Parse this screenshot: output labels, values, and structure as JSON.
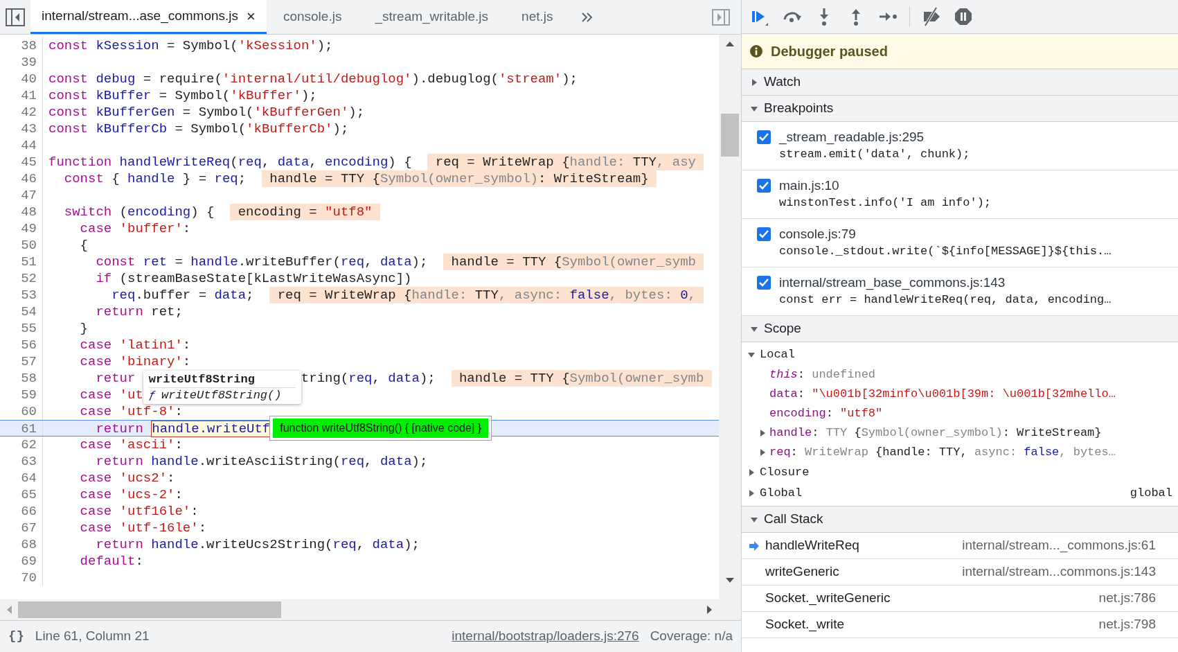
{
  "tabs": [
    {
      "label": "internal/stream...ase_commons.js",
      "selected": true,
      "close": "×"
    },
    {
      "label": "console.js",
      "selected": false
    },
    {
      "label": "_stream_writable.js",
      "selected": false
    },
    {
      "label": "net.js",
      "selected": false
    }
  ],
  "code": {
    "lines": [
      {
        "number": "38",
        "current": false,
        "tokens": [
          {
            "kind": "keyword",
            "text": "const"
          },
          {
            "kind": "variable",
            "text": " kSession"
          },
          {
            "kind": "plain",
            "text": " = Symbol("
          },
          {
            "kind": "string",
            "text": "'kSession'"
          },
          {
            "kind": "plain",
            "text": ");"
          }
        ]
      },
      {
        "number": "39",
        "current": false
      },
      {
        "number": "40",
        "current": false,
        "tokens": [
          {
            "kind": "keyword",
            "text": "const"
          },
          {
            "kind": "variable",
            "text": " debug"
          },
          {
            "kind": "plain",
            "text": " = require("
          },
          {
            "kind": "string",
            "text": "'internal/util/debuglog'"
          },
          {
            "kind": "plain",
            "text": ").debuglog("
          },
          {
            "kind": "string",
            "text": "'stream'"
          },
          {
            "kind": "plain",
            "text": ");"
          }
        ]
      },
      {
        "number": "41",
        "current": false,
        "tokens": [
          {
            "kind": "keyword",
            "text": "const"
          },
          {
            "kind": "variable",
            "text": " kBuffer"
          },
          {
            "kind": "plain",
            "text": " = Symbol("
          },
          {
            "kind": "string",
            "text": "'kBuffer'"
          },
          {
            "kind": "plain",
            "text": ");"
          }
        ]
      },
      {
        "number": "42",
        "current": false,
        "tokens": [
          {
            "kind": "keyword",
            "text": "const"
          },
          {
            "kind": "variable",
            "text": " kBufferGen"
          },
          {
            "kind": "plain",
            "text": " = Symbol("
          },
          {
            "kind": "string",
            "text": "'kBufferGen'"
          },
          {
            "kind": "plain",
            "text": ");"
          }
        ]
      },
      {
        "number": "43",
        "current": false,
        "tokens": [
          {
            "kind": "keyword",
            "text": "const"
          },
          {
            "kind": "variable",
            "text": " kBufferCb"
          },
          {
            "kind": "plain",
            "text": " = Symbol("
          },
          {
            "kind": "string",
            "text": "'kBufferCb'"
          },
          {
            "kind": "plain",
            "text": ");"
          }
        ]
      },
      {
        "number": "44",
        "current": false
      },
      {
        "number": "45",
        "current": false,
        "tokens": [
          {
            "kind": "keyword",
            "text": "function"
          },
          {
            "kind": "variable",
            "text": " handleWriteReq"
          },
          {
            "kind": "plain",
            "text": "("
          },
          {
            "kind": "variable",
            "text": "req"
          },
          {
            "kind": "plain",
            "text": ", "
          },
          {
            "kind": "variable",
            "text": "data"
          },
          {
            "kind": "plain",
            "text": ", "
          },
          {
            "kind": "variable",
            "text": "encoding"
          },
          {
            "kind": "plain",
            "text": ") {"
          }
        ],
        "inline_value": [
          {
            "kind": "plain",
            "text": "req = WriteWrap {"
          },
          {
            "kind": "dim",
            "text": "handle: "
          },
          {
            "kind": "plain",
            "text": "TTY"
          },
          {
            "kind": "dim",
            "text": ", asy"
          }
        ]
      },
      {
        "number": "46",
        "current": false,
        "tokens": [
          {
            "kind": "keyword",
            "text": "  const"
          },
          {
            "kind": "plain",
            "text": " { "
          },
          {
            "kind": "variable",
            "text": "handle"
          },
          {
            "kind": "plain",
            "text": " } = "
          },
          {
            "kind": "variable",
            "text": "req"
          },
          {
            "kind": "plain",
            "text": ";"
          }
        ],
        "inline_value": [
          {
            "kind": "plain",
            "text": "handle = TTY {"
          },
          {
            "kind": "dim",
            "text": "Symbol(owner_symbol)"
          },
          {
            "kind": "plain",
            "text": ": WriteStream}"
          }
        ]
      },
      {
        "number": "47",
        "current": false
      },
      {
        "number": "48",
        "current": false,
        "tokens": [
          {
            "kind": "keyword",
            "text": "  switch"
          },
          {
            "kind": "plain",
            "text": " ("
          },
          {
            "kind": "variable",
            "text": "encoding"
          },
          {
            "kind": "plain",
            "text": ") {"
          }
        ],
        "inline_value": [
          {
            "kind": "plain",
            "text": "encoding = "
          },
          {
            "kind": "string",
            "text": "\"utf8\""
          }
        ]
      },
      {
        "number": "49",
        "current": false,
        "tokens": [
          {
            "kind": "keyword",
            "text": "    case"
          },
          {
            "kind": "string",
            "text": " 'buffer'"
          },
          {
            "kind": "plain",
            "text": ":"
          }
        ]
      },
      {
        "number": "50",
        "current": false,
        "tokens": [
          {
            "kind": "plain",
            "text": "    {"
          }
        ]
      },
      {
        "number": "51",
        "current": false,
        "tokens": [
          {
            "kind": "keyword",
            "text": "      const"
          },
          {
            "kind": "variable",
            "text": " ret"
          },
          {
            "kind": "plain",
            "text": " = "
          },
          {
            "kind": "variable",
            "text": "handle"
          },
          {
            "kind": "plain",
            "text": ".writeBuffer("
          },
          {
            "kind": "variable",
            "text": "req"
          },
          {
            "kind": "plain",
            "text": ", "
          },
          {
            "kind": "variable",
            "text": "data"
          },
          {
            "kind": "plain",
            "text": ");"
          }
        ],
        "inline_value": [
          {
            "kind": "plain",
            "text": "handle = TTY {"
          },
          {
            "kind": "dim",
            "text": "Symbol(owner_symb"
          }
        ]
      },
      {
        "number": "52",
        "current": false,
        "tokens": [
          {
            "kind": "keyword",
            "text": "      if"
          },
          {
            "kind": "plain",
            "text": " (streamBaseState[kLastWriteWasAsync])"
          }
        ]
      },
      {
        "number": "53",
        "current": false,
        "tokens": [
          {
            "kind": "variable",
            "text": "        req"
          },
          {
            "kind": "plain",
            "text": ".buffer = "
          },
          {
            "kind": "variable",
            "text": "data"
          },
          {
            "kind": "plain",
            "text": ";"
          }
        ],
        "inline_value": [
          {
            "kind": "plain",
            "text": "req = WriteWrap {"
          },
          {
            "kind": "dim",
            "text": "handle: "
          },
          {
            "kind": "plain",
            "text": "TTY"
          },
          {
            "kind": "dim",
            "text": ", async: "
          },
          {
            "kind": "literal",
            "text": "false"
          },
          {
            "kind": "dim",
            "text": ", bytes: "
          },
          {
            "kind": "literal",
            "text": "0"
          },
          {
            "kind": "dim",
            "text": ","
          }
        ]
      },
      {
        "number": "54",
        "current": false,
        "tokens": [
          {
            "kind": "keyword",
            "text": "      return"
          },
          {
            "kind": "plain",
            "text": " ret;"
          }
        ]
      },
      {
        "number": "55",
        "current": false,
        "tokens": [
          {
            "kind": "plain",
            "text": "    }"
          }
        ]
      },
      {
        "number": "56",
        "current": false,
        "tokens": [
          {
            "kind": "keyword",
            "text": "    case"
          },
          {
            "kind": "string",
            "text": " 'latin1'"
          },
          {
            "kind": "plain",
            "text": ":"
          }
        ]
      },
      {
        "number": "57",
        "current": false,
        "tokens": [
          {
            "kind": "keyword",
            "text": "    case"
          },
          {
            "kind": "string",
            "text": " 'binary'"
          },
          {
            "kind": "plain",
            "text": ":"
          }
        ]
      },
      {
        "number": "58",
        "current": false,
        "tokens": [
          {
            "kind": "keyword",
            "text": "      retur"
          },
          {
            "kind": "gap"
          },
          {
            "kind": "plain",
            "text": "tring("
          },
          {
            "kind": "variable",
            "text": "req"
          },
          {
            "kind": "plain",
            "text": ", "
          },
          {
            "kind": "variable",
            "text": "data"
          },
          {
            "kind": "plain",
            "text": ");"
          }
        ],
        "inline_value": [
          {
            "kind": "plain",
            "text": "handle = TTY {"
          },
          {
            "kind": "dim",
            "text": "Symbol(owner_symb"
          }
        ]
      },
      {
        "number": "59",
        "current": false,
        "tokens": [
          {
            "kind": "keyword",
            "text": "    case"
          },
          {
            "kind": "string",
            "text": " 'ut"
          }
        ]
      },
      {
        "number": "60",
        "current": false,
        "tokens": [
          {
            "kind": "keyword",
            "text": "    case"
          },
          {
            "kind": "string",
            "text": " 'utf-8'"
          },
          {
            "kind": "plain",
            "text": ":"
          }
        ]
      },
      {
        "number": "61",
        "current": true,
        "tokens": [
          {
            "kind": "keyword",
            "text": "      return "
          },
          {
            "kind": "hovered",
            "text": "handle.writeUtf"
          }
        ]
      },
      {
        "number": "62",
        "current": false,
        "tokens": [
          {
            "kind": "keyword",
            "text": "    case"
          },
          {
            "kind": "string",
            "text": " 'ascii'"
          },
          {
            "kind": "plain",
            "text": ":"
          }
        ]
      },
      {
        "number": "63",
        "current": false,
        "tokens": [
          {
            "kind": "keyword",
            "text": "      return"
          },
          {
            "kind": "variable",
            "text": " handle"
          },
          {
            "kind": "plain",
            "text": ".writeAsciiString("
          },
          {
            "kind": "variable",
            "text": "req"
          },
          {
            "kind": "plain",
            "text": ", "
          },
          {
            "kind": "variable",
            "text": "data"
          },
          {
            "kind": "plain",
            "text": ");"
          }
        ]
      },
      {
        "number": "64",
        "current": false,
        "tokens": [
          {
            "kind": "keyword",
            "text": "    case"
          },
          {
            "kind": "string",
            "text": " 'ucs2'"
          },
          {
            "kind": "plain",
            "text": ":"
          }
        ]
      },
      {
        "number": "65",
        "current": false,
        "tokens": [
          {
            "kind": "keyword",
            "text": "    case"
          },
          {
            "kind": "string",
            "text": " 'ucs-2'"
          },
          {
            "kind": "plain",
            "text": ":"
          }
        ]
      },
      {
        "number": "66",
        "current": false,
        "tokens": [
          {
            "kind": "keyword",
            "text": "    case"
          },
          {
            "kind": "string",
            "text": " 'utf16le'"
          },
          {
            "kind": "plain",
            "text": ":"
          }
        ]
      },
      {
        "number": "67",
        "current": false,
        "tokens": [
          {
            "kind": "keyword",
            "text": "    case"
          },
          {
            "kind": "string",
            "text": " 'utf-16le'"
          },
          {
            "kind": "plain",
            "text": ":"
          }
        ]
      },
      {
        "number": "68",
        "current": false,
        "tokens": [
          {
            "kind": "keyword",
            "text": "      return"
          },
          {
            "kind": "variable",
            "text": " handle"
          },
          {
            "kind": "plain",
            "text": ".writeUcs2String("
          },
          {
            "kind": "variable",
            "text": "req"
          },
          {
            "kind": "plain",
            "text": ", "
          },
          {
            "kind": "variable",
            "text": "data"
          },
          {
            "kind": "plain",
            "text": ");"
          }
        ]
      },
      {
        "number": "69",
        "current": false,
        "tokens": [
          {
            "kind": "keyword",
            "text": "    default"
          },
          {
            "kind": "plain",
            "text": ":"
          }
        ]
      },
      {
        "number": "70",
        "current": false
      }
    ],
    "popover": {
      "title": "writeUtf8String",
      "glyph": "ƒ",
      "signature": "writeUtf8String()"
    },
    "value_tooltip": "function writeUtf8String() { [native code] }"
  },
  "status_bar": {
    "format": "{}",
    "position": "Line 61, Column 21",
    "link": "internal/bootstrap/loaders.js:276",
    "coverage": "Coverage: n/a"
  },
  "paused_banner": "Debugger paused",
  "watch": {
    "title": "Watch",
    "expanded": false
  },
  "breakpoints": {
    "title": "Breakpoints",
    "expanded": true,
    "items": [
      {
        "location": "_stream_readable.js:295",
        "code": "stream.emit('data', chunk);",
        "checked": true
      },
      {
        "location": "main.js:10",
        "code": "winstonTest.info('I am info');",
        "checked": true
      },
      {
        "location": "console.js:79",
        "code": "console._stdout.write(`${info[MESSAGE]}${this.…",
        "checked": true
      },
      {
        "location": "internal/stream_base_commons.js:143",
        "code": "const err = handleWriteReq(req, data, encoding…",
        "checked": true
      }
    ]
  },
  "scope": {
    "title": "Scope",
    "expanded": true,
    "groups": [
      {
        "name": "Local",
        "expanded": true,
        "entries": [
          {
            "name": "this",
            "special": true,
            "kind": "leaf",
            "value": [
              {
                "kind": "plain",
                "text": ": "
              },
              {
                "kind": "dim",
                "text": "undefined"
              }
            ]
          },
          {
            "name": "data",
            "special": false,
            "kind": "leaf",
            "value": [
              {
                "kind": "plain",
                "text": ": "
              },
              {
                "kind": "string",
                "text": "\"\\u001b[32minfo\\u001b[39m: \\u001b[32mhello…"
              }
            ]
          },
          {
            "name": "encoding",
            "special": false,
            "kind": "leaf",
            "value": [
              {
                "kind": "plain",
                "text": ": "
              },
              {
                "kind": "string",
                "text": "\"utf8\""
              }
            ]
          },
          {
            "name": "handle",
            "special": false,
            "kind": "object",
            "expanded": false,
            "value": [
              {
                "kind": "plain",
                "text": ": "
              },
              {
                "kind": "dim",
                "text": "TTY "
              },
              {
                "kind": "plain",
                "text": "{"
              },
              {
                "kind": "dim",
                "text": "Symbol(owner_symbol)"
              },
              {
                "kind": "plain",
                "text": ": WriteStream}"
              }
            ]
          },
          {
            "name": "req",
            "special": false,
            "kind": "object",
            "expanded": false,
            "value": [
              {
                "kind": "plain",
                "text": ": "
              },
              {
                "kind": "dim",
                "text": "WriteWrap "
              },
              {
                "kind": "plain",
                "text": "{handle: TTY, "
              },
              {
                "kind": "dim",
                "text": "async: "
              },
              {
                "kind": "literal",
                "text": "false"
              },
              {
                "kind": "dim",
                "text": ", bytes…"
              }
            ]
          }
        ]
      },
      {
        "name": "Closure",
        "expanded": false
      },
      {
        "name": "Global",
        "expanded": false,
        "value": "global"
      }
    ]
  },
  "call_stack": {
    "title": "Call Stack",
    "expanded": true,
    "frames": [
      {
        "function": "handleWriteReq",
        "location": "internal/stream..._commons.js:61",
        "current": true
      },
      {
        "function": "writeGeneric",
        "location": "internal/stream...commons.js:143",
        "current": false
      },
      {
        "function": "Socket._writeGeneric",
        "location": "net.js:786",
        "current": false
      },
      {
        "function": "Socket._write",
        "location": "net.js:798",
        "current": false
      }
    ]
  }
}
